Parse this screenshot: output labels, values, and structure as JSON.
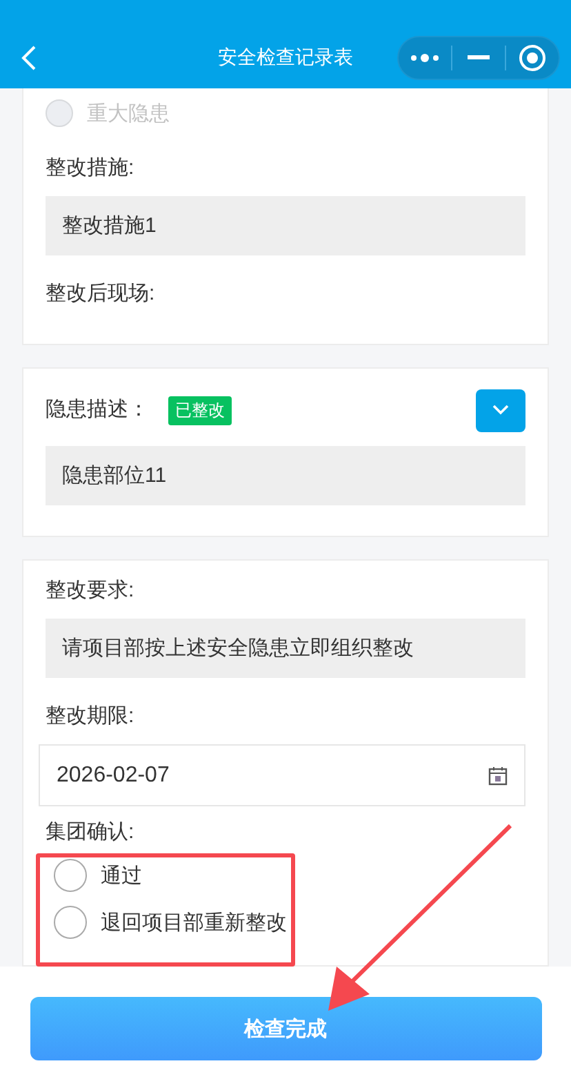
{
  "header": {
    "title": "安全检查记录表"
  },
  "hazard_card": {
    "level_option": {
      "label": "重大隐患",
      "selected": false,
      "disabled": true
    },
    "measures_label": "整改措施:",
    "measures_value": "整改措施1",
    "after_label": "整改后现场:"
  },
  "description_card": {
    "label": "隐患描述：",
    "status_tag": "已整改",
    "expanded": false,
    "value": "隐患部位11"
  },
  "review_card": {
    "requirement_label": "整改要求:",
    "requirement_value": "请项目部按上述安全隐患立即组织整改",
    "deadline_label": "整改期限:",
    "deadline_value": "2026-02-07",
    "confirm_label": "集团确认:",
    "confirm_options": [
      {
        "label": "通过",
        "selected": false
      },
      {
        "label": "退回项目部重新整改",
        "selected": false
      }
    ]
  },
  "submit_button": "检查完成"
}
